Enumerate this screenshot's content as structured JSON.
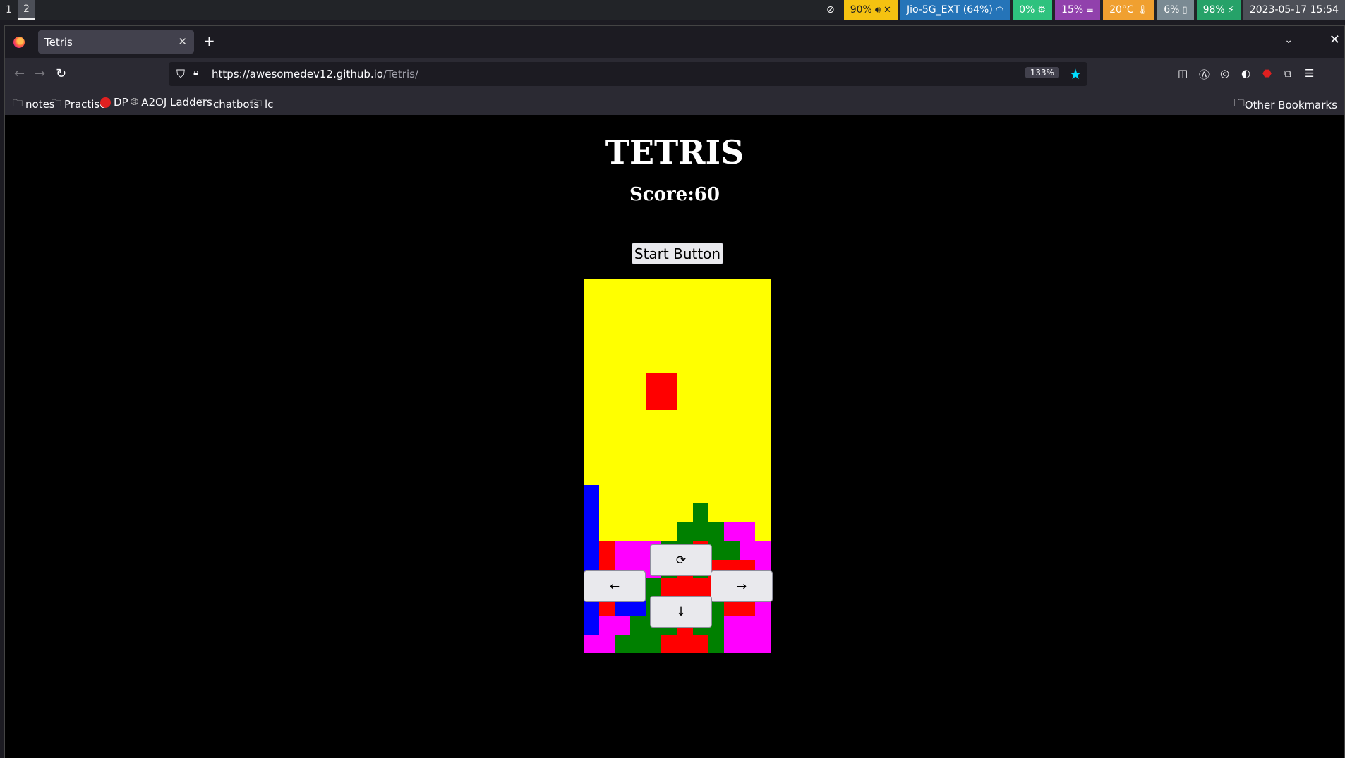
{
  "system_bar": {
    "workspaces": [
      "1",
      "2"
    ],
    "active_workspace": "2",
    "volume": "90%",
    "wifi": "Jio-5G_EXT (64%)",
    "cpu": "0%",
    "memory": "15%",
    "temperature": "20°C",
    "disk": "6%",
    "battery": "98%",
    "datetime": "2023-05-17  15:54",
    "colors": {
      "volume": "#f5c211",
      "wifi": "#2574b8",
      "cpu": "#2ec27e",
      "memory": "#9141ac",
      "temperature": "#f0a030",
      "disk": "#7a8a93",
      "battery": "#26a269",
      "datetime": "#4c4f57"
    }
  },
  "browser": {
    "tab_title": "Tetris",
    "url_base": "https://awesomedev12.github.io",
    "url_path": "/Tetris/",
    "zoom": "133%",
    "bookmarks": [
      "notes",
      "Practise",
      "DP",
      "A2OJ Ladders",
      "chatbots",
      "lc"
    ],
    "other_bookmarks": "Other Bookmarks"
  },
  "game": {
    "title": "TETRIS",
    "score_text": "Score:60",
    "start_label": "Start Button",
    "controls": {
      "rotate": "⟳",
      "left": "←",
      "right": "→",
      "down": "↓"
    },
    "colors": [
      "#ffff00",
      "#ff0000",
      "#0000ff",
      "#008000",
      "#ff00ff"
    ],
    "board": [
      "000000000000",
      "000000000000",
      "000000000000",
      "000000000000",
      "000000000000",
      "000011000000",
      "000011000000",
      "000000000000",
      "000000000000",
      "000000000000",
      "000000000000",
      "200000000000",
      "200000030000",
      "200000333440",
      "214443313344",
      "214443131114",
      "212231111114",
      "212233333114",
      "244333133444",
      "443331113444"
    ]
  }
}
